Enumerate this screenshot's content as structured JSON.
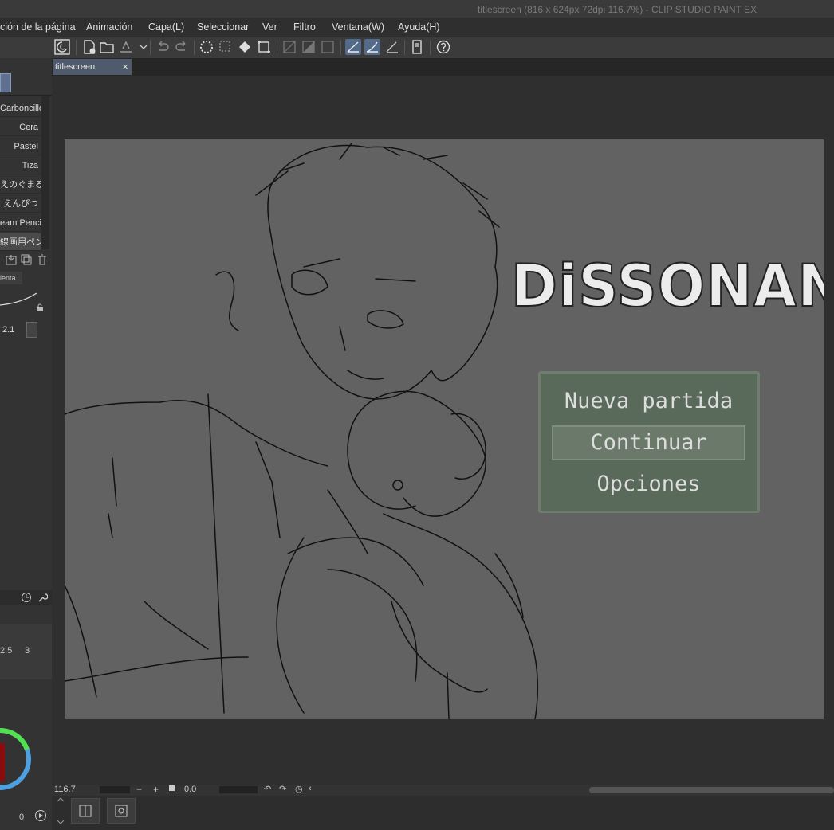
{
  "window": {
    "title": "titlescreen (816 x 624px 72dpi 116.7%)  - CLIP STUDIO PAINT EX"
  },
  "menu": [
    "ción de la página",
    "Animación",
    "Capa(L)",
    "Seleccionar",
    "Ver",
    "Filtro",
    "Ventana(W)",
    "Ayuda(H)"
  ],
  "brushes": [
    "Carboncillo",
    "Cera",
    "Pastel",
    "Tiza",
    "えのぐまる",
    "えんぴつ",
    "eam Pencil",
    "線画用ペン"
  ],
  "tool_tab": "ienta",
  "brush_size": "2.1",
  "size_marks": [
    "2.5",
    "3"
  ],
  "color_value": "0",
  "document_tab": {
    "name": "titlescreen",
    "close": "×"
  },
  "game": {
    "logo": "DiSSONANCE",
    "menu_items": [
      "Nueva partida",
      "Continuar",
      "Opciones"
    ],
    "selected_index": 1
  },
  "status": {
    "zoom": "116.7",
    "rotation": "0.0"
  },
  "colors": {
    "accent": "#546a8a",
    "canvas": "#626262",
    "menu_box": "#5a6a5a"
  }
}
